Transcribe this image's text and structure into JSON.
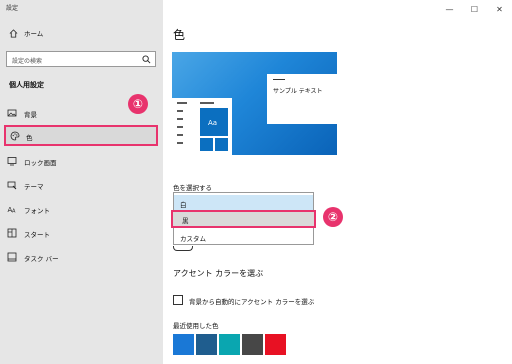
{
  "window": {
    "title": "設定",
    "minimize_glyph": "—",
    "maximize_glyph": "☐",
    "close_glyph": "✕"
  },
  "sidebar": {
    "home_label": "ホーム",
    "search_placeholder": "設定の検索",
    "section_title": "個人用設定",
    "items": [
      {
        "label": "背景",
        "icon": "image-icon"
      },
      {
        "label": "色",
        "icon": "palette-icon",
        "selected": true
      },
      {
        "label": "ロック画面",
        "icon": "lock-screen-icon"
      },
      {
        "label": "テーマ",
        "icon": "brush-icon"
      },
      {
        "label": "フォント",
        "icon": "font-icon"
      },
      {
        "label": "スタート",
        "icon": "start-icon"
      },
      {
        "label": "タスク バー",
        "icon": "taskbar-icon"
      }
    ]
  },
  "annotations": {
    "marker_1": "①",
    "marker_2": "②",
    "highlight_color": "#e8336d"
  },
  "main": {
    "title": "色",
    "preview": {
      "tile_text": "Aa",
      "window_text": "サンプル テキスト"
    },
    "choose_color_label": "色を選択する",
    "dropdown_options": [
      "白",
      "黒",
      "カスタム"
    ],
    "dropdown_selected": "黒",
    "accent_title": "アクセント カラーを選ぶ",
    "auto_accent_label": "背景から自動的にアクセント カラーを選ぶ",
    "recent_colors_label": "最近使用した色",
    "recent_colors": [
      "#1a78d6",
      "#1f5d8e",
      "#0aa6b0",
      "#474747",
      "#e81123"
    ]
  }
}
